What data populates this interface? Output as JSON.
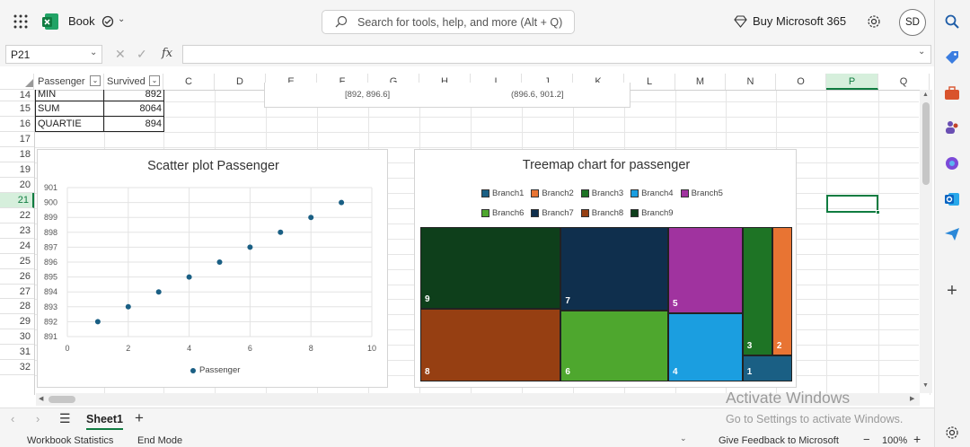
{
  "app": {
    "book_title": "Book",
    "search_placeholder": "Search for tools, help, and more (Alt + Q)",
    "buy_label": "Buy Microsoft 365",
    "avatar_initials": "SD"
  },
  "formula_bar": {
    "name_box": "P21",
    "fx_label": "fx",
    "formula": ""
  },
  "columns": [
    {
      "label": "Passenger"
    },
    {
      "label": "Survived"
    },
    {
      "label": "C"
    },
    {
      "label": "D"
    },
    {
      "label": "E"
    },
    {
      "label": "F"
    },
    {
      "label": "G"
    },
    {
      "label": "H"
    },
    {
      "label": "I"
    },
    {
      "label": "J"
    },
    {
      "label": "K"
    },
    {
      "label": "L"
    },
    {
      "label": "M"
    },
    {
      "label": "N"
    },
    {
      "label": "O"
    },
    {
      "label": "P"
    },
    {
      "label": "Q"
    }
  ],
  "rows": [
    "14",
    "15",
    "16",
    "17",
    "18",
    "19",
    "20",
    "21",
    "22",
    "23",
    "24",
    "25",
    "26",
    "27",
    "28",
    "29",
    "30",
    "31",
    "32"
  ],
  "cells": {
    "r14_label": "MIN",
    "r14_value": "892",
    "r15_label": "SUM",
    "r15_value": "8064",
    "r16_label": "QUARTIE",
    "r16_value": "894",
    "bin1": "[892, 896.6]",
    "bin2": "(896.6, 901.2]"
  },
  "scatter": {
    "title": "Scatter plot Passenger",
    "legend": "Passenger",
    "y_ticks": [
      "901",
      "900",
      "899",
      "898",
      "897",
      "896",
      "895",
      "894",
      "893",
      "892",
      "891"
    ],
    "x_ticks": [
      "0",
      "2",
      "4",
      "6",
      "8",
      "10"
    ]
  },
  "treemap": {
    "title": "Treemap chart for passenger",
    "legend": [
      {
        "label": "Branch1",
        "color": "#1a5f84"
      },
      {
        "label": "Branch2",
        "color": "#e87433"
      },
      {
        "label": "Branch3",
        "color": "#1e7425"
      },
      {
        "label": "Branch4",
        "color": "#1b9ee0"
      },
      {
        "label": "Branch5",
        "color": "#a0339f"
      },
      {
        "label": "Branch6",
        "color": "#4ea72e"
      },
      {
        "label": "Branch7",
        "color": "#0f2f4d"
      },
      {
        "label": "Branch8",
        "color": "#963f12"
      },
      {
        "label": "Branch9",
        "color": "#0e3f1b"
      }
    ],
    "labels": {
      "b1": "1",
      "b2": "2",
      "b3": "3",
      "b4": "4",
      "b5": "5",
      "b6": "6",
      "b7": "7",
      "b8": "8",
      "b9": "9"
    }
  },
  "chart_data": [
    {
      "type": "scatter",
      "title": "Scatter plot Passenger",
      "series": [
        {
          "name": "Passenger",
          "x": [
            1,
            2,
            3,
            4,
            5,
            6,
            7,
            8,
            9
          ],
          "y": [
            892,
            893,
            894,
            895,
            896,
            897,
            898,
            899,
            900
          ]
        }
      ],
      "xlim": [
        0,
        10
      ],
      "ylim": [
        891,
        901
      ],
      "grid": true,
      "legend": "bottom"
    },
    {
      "type": "treemap",
      "title": "Treemap chart for passenger",
      "categories": [
        "Branch1",
        "Branch2",
        "Branch3",
        "Branch4",
        "Branch5",
        "Branch6",
        "Branch7",
        "Branch8",
        "Branch9"
      ],
      "values": [
        1,
        2,
        3,
        4,
        5,
        6,
        7,
        8,
        9
      ],
      "legend": "top"
    }
  ],
  "sheet": {
    "tab": "Sheet1",
    "status_left": "Workbook Statistics",
    "status_mode": "End Mode",
    "feedback": "Give Feedback to Microsoft",
    "zoom": "100%"
  },
  "watermark": {
    "line1": "Activate Windows",
    "line2": "Go to Settings to activate Windows."
  },
  "colors": {
    "excel_green": "#107c41",
    "marker": "#1a5f84"
  }
}
